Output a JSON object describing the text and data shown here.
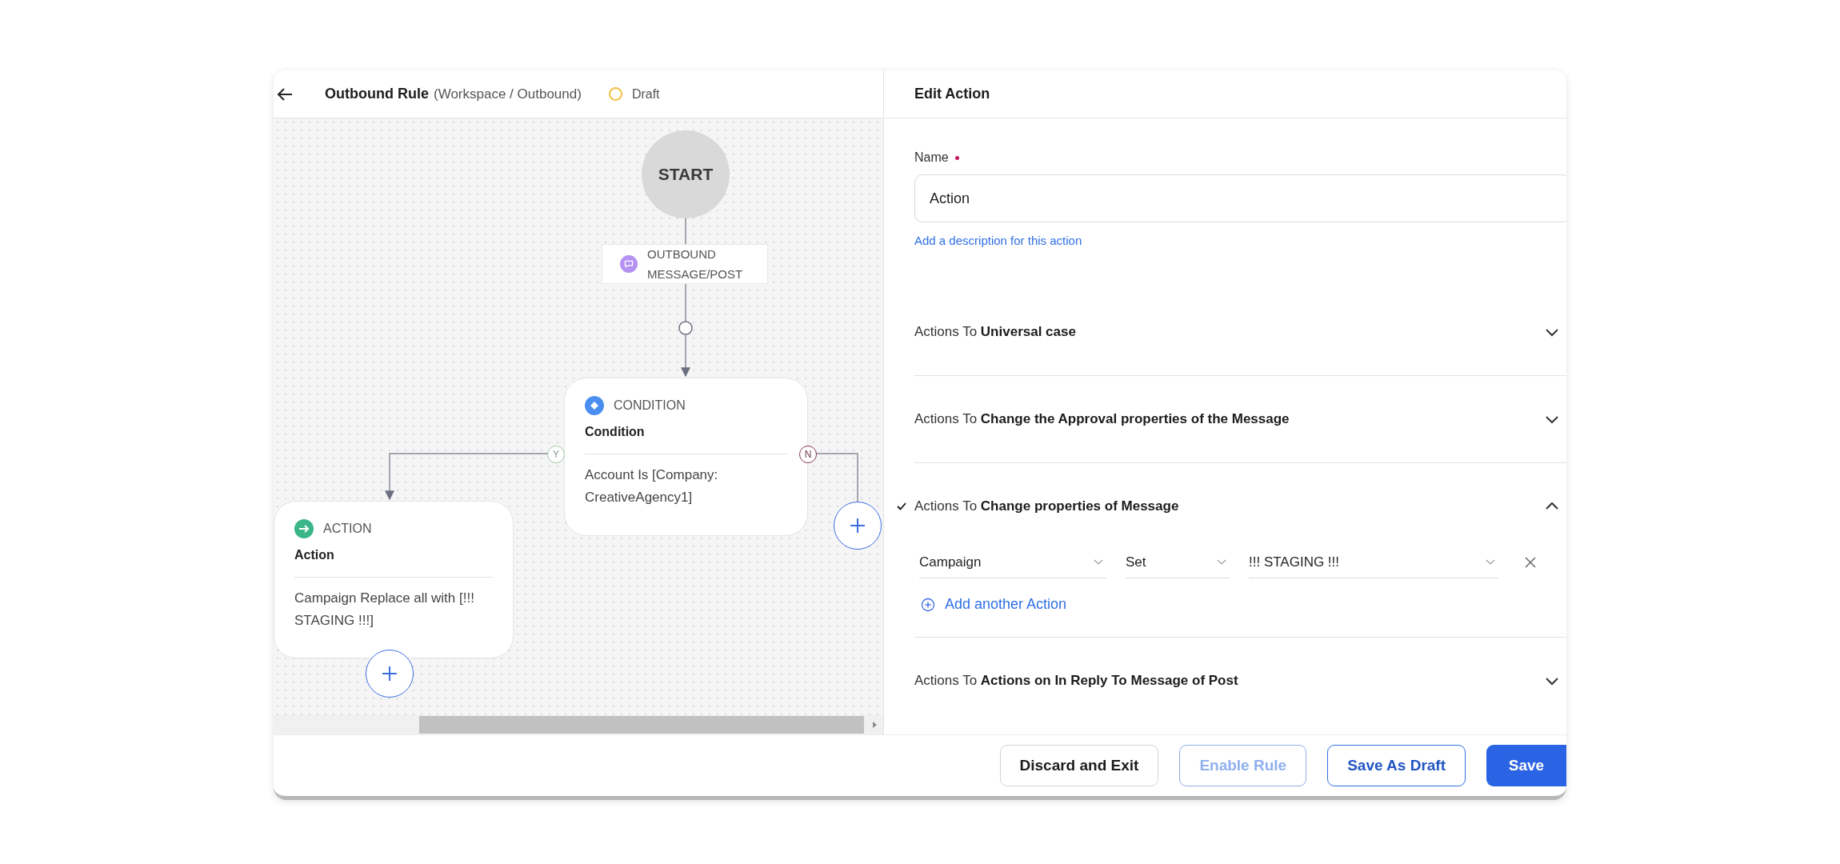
{
  "header": {
    "title": "Outbound Rule",
    "path": "(Workspace / Outbound)",
    "status": "Draft"
  },
  "canvas": {
    "start": "START",
    "trigger": "OUTBOUND MESSAGE/POST",
    "nodes": [
      {
        "kind": "condition",
        "type_label": "CONDITION",
        "title": "Condition",
        "detail": "Account Is [Company: CreativeAgency1]"
      },
      {
        "kind": "action",
        "type_label": "ACTION",
        "title": "Action",
        "detail": "Campaign Replace all with [!!! STAGING !!!]"
      }
    ],
    "branches": {
      "yes": "Y",
      "no": "N"
    }
  },
  "panel": {
    "title": "Edit Action",
    "name_label": "Name",
    "name_required": true,
    "name_value": "Action",
    "description_link": "Add a description for this action",
    "sections": [
      {
        "heading": "Actions To **Universal case**",
        "expanded": false,
        "checked": false
      },
      {
        "heading": "Actions To **Change the Approval properties of the Message**",
        "expanded": false,
        "checked": false
      },
      {
        "heading": "Actions To **Change properties of Message**",
        "expanded": true,
        "checked": true,
        "rows": [
          {
            "field": "Campaign",
            "operator": "Set",
            "value": "!!! STAGING !!!"
          }
        ],
        "add_label": "Add another Action"
      },
      {
        "heading": "Actions To **Actions on In Reply To Message of Post**",
        "expanded": false,
        "checked": false
      }
    ]
  },
  "footer": {
    "buttons": [
      {
        "label": "Discard and Exit",
        "kind": "secondary",
        "disabled": false
      },
      {
        "label": "Enable Rule",
        "kind": "outline",
        "disabled": true
      },
      {
        "label": "Save As Draft",
        "kind": "outline",
        "disabled": false
      },
      {
        "label": "Save",
        "kind": "primary",
        "disabled": false
      }
    ]
  }
}
